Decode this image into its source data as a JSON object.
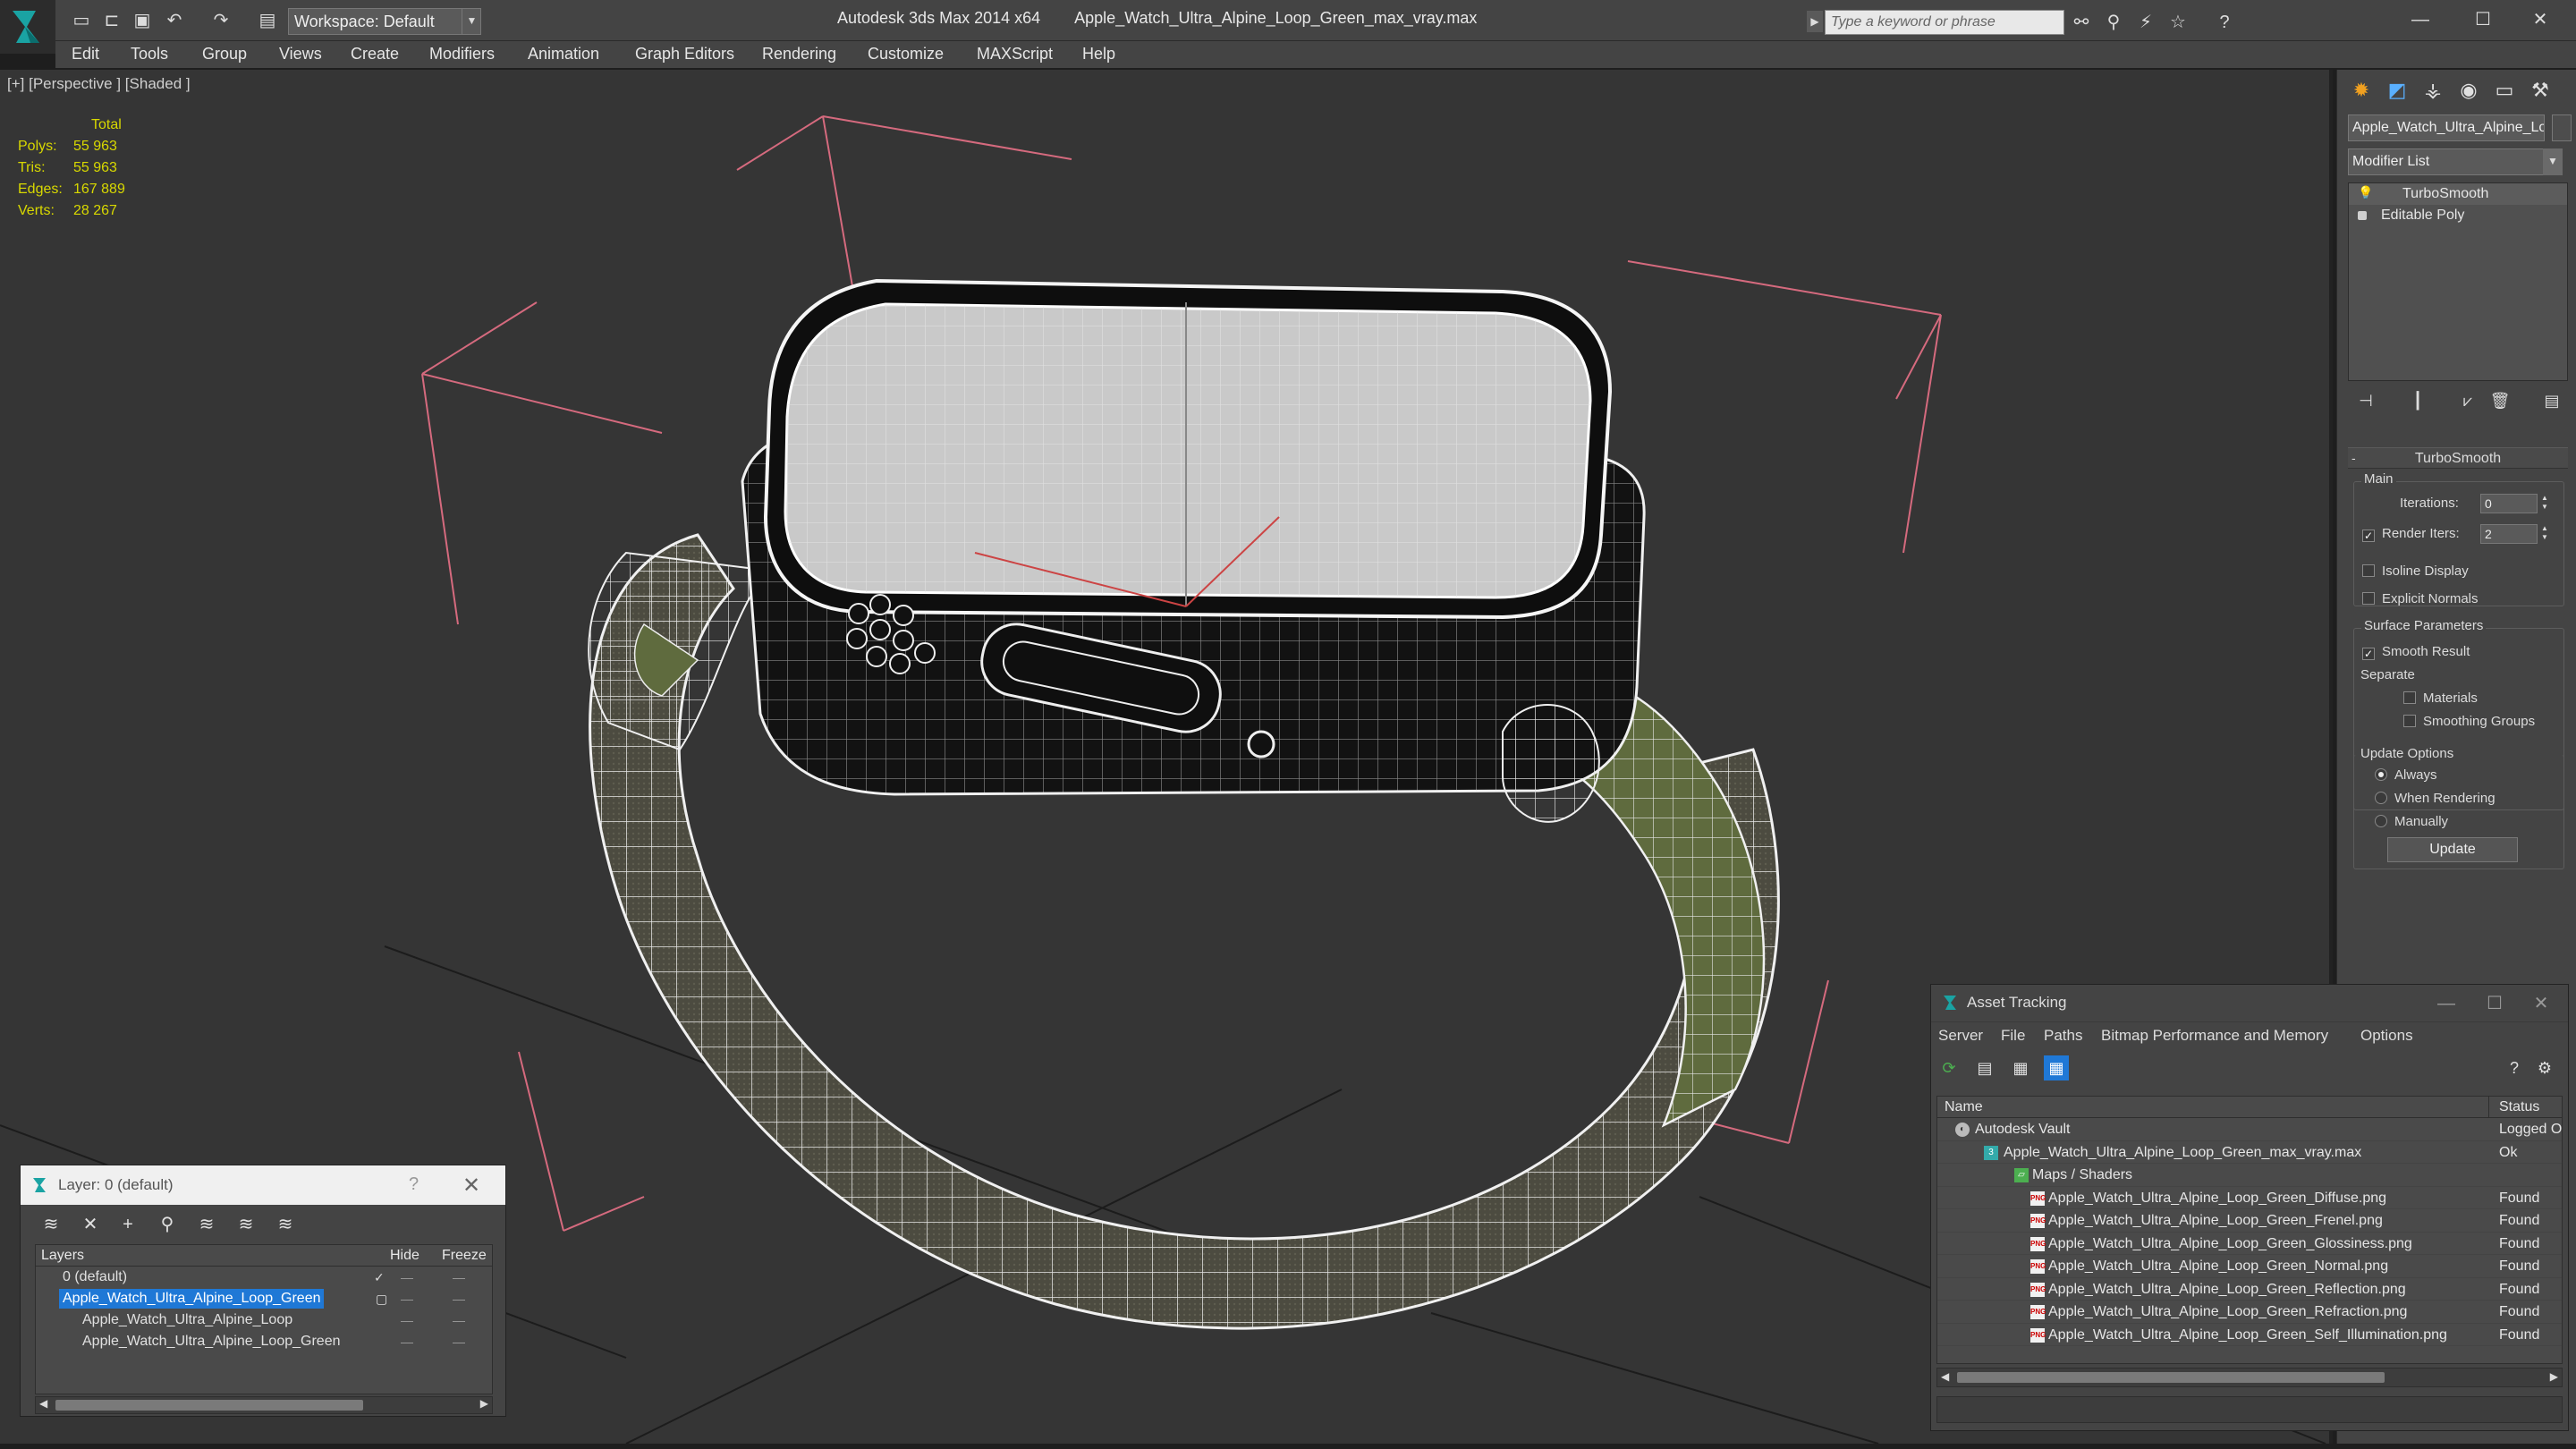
{
  "titlebar": {
    "app": "Autodesk 3ds Max  2014 x64",
    "file": "Apple_Watch_Ultra_Alpine_Loop_Green_max_vray.max",
    "workspace": "Workspace: Default",
    "search_placeholder": "Type a keyword or phrase"
  },
  "menu": [
    "Edit",
    "Tools",
    "Group",
    "Views",
    "Create",
    "Modifiers",
    "Animation",
    "Graph Editors",
    "Rendering",
    "Customize",
    "MAXScript",
    "Help"
  ],
  "viewport": {
    "label": "[+] [Perspective ] [Shaded ]",
    "stats": {
      "header": "Total",
      "rows": [
        {
          "k": "Polys:",
          "v": "55 963"
        },
        {
          "k": "Tris:",
          "v": "55 963"
        },
        {
          "k": "Edges:",
          "v": "167 889"
        },
        {
          "k": "Verts:",
          "v": "28 267"
        }
      ]
    }
  },
  "command_panel": {
    "object_name": "Apple_Watch_Ultra_Alpine_Loop_Green",
    "modifier_list": "Modifier List",
    "stack": [
      "TurboSmooth",
      "Editable Poly"
    ],
    "rollout": "TurboSmooth",
    "main_group": "Main",
    "iterations_label": "Iterations:",
    "iterations_value": "0",
    "render_iters_label": "Render Iters:",
    "render_iters_value": "2",
    "isoline": "Isoline Display",
    "explicit_normals": "Explicit Normals",
    "surface_group": "Surface Parameters",
    "smooth_result": "Smooth Result",
    "separate": "Separate",
    "materials": "Materials",
    "smoothing_groups": "Smoothing Groups",
    "update_group": "Update Options",
    "always": "Always",
    "when_rendering": "When Rendering",
    "manually": "Manually",
    "update_btn": "Update"
  },
  "layer_window": {
    "title": "Layer: 0 (default)",
    "help": "?",
    "col_layers": "Layers",
    "col_hide": "Hide",
    "col_freeze": "Freeze",
    "rows": [
      {
        "name": "0 (default)"
      },
      {
        "name": "Apple_Watch_Ultra_Alpine_Loop_Green"
      },
      {
        "name": "Apple_Watch_Ultra_Alpine_Loop"
      },
      {
        "name": "Apple_Watch_Ultra_Alpine_Loop_Green"
      }
    ]
  },
  "asset_window": {
    "title": "Asset Tracking",
    "menu": [
      "Server",
      "File",
      "Paths",
      "Bitmap Performance and Memory",
      "Options"
    ],
    "col_name": "Name",
    "col_status": "Status",
    "rows": [
      {
        "name": "Autodesk Vault",
        "status": "Logged O"
      },
      {
        "name": "Apple_Watch_Ultra_Alpine_Loop_Green_max_vray.max",
        "status": "Ok"
      },
      {
        "name": "Maps / Shaders",
        "status": ""
      },
      {
        "name": "Apple_Watch_Ultra_Alpine_Loop_Green_Diffuse.png",
        "status": "Found"
      },
      {
        "name": "Apple_Watch_Ultra_Alpine_Loop_Green_Frenel.png",
        "status": "Found"
      },
      {
        "name": "Apple_Watch_Ultra_Alpine_Loop_Green_Glossiness.png",
        "status": "Found"
      },
      {
        "name": "Apple_Watch_Ultra_Alpine_Loop_Green_Normal.png",
        "status": "Found"
      },
      {
        "name": "Apple_Watch_Ultra_Alpine_Loop_Green_Reflection.png",
        "status": "Found"
      },
      {
        "name": "Apple_Watch_Ultra_Alpine_Loop_Green_Refraction.png",
        "status": "Found"
      },
      {
        "name": "Apple_Watch_Ultra_Alpine_Loop_Green_Self_Illumination.png",
        "status": "Found"
      }
    ]
  },
  "colors": {
    "stats": "#d8d800",
    "selection": "#1f78d6",
    "viewport_bg": "#353535",
    "panel_bg": "#444444"
  }
}
